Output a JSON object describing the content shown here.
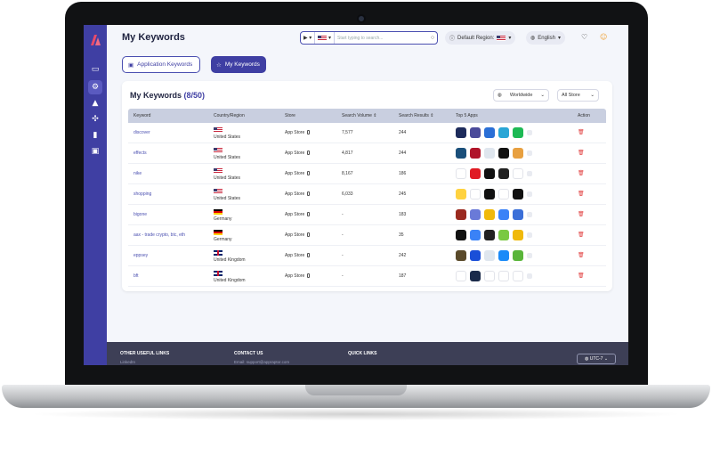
{
  "page": {
    "title": "My Keywords"
  },
  "header": {
    "search_placeholder": "Start typing to search...",
    "default_region_label": "Default Region:",
    "language": "English"
  },
  "tabs": [
    {
      "label": "Application Keywords",
      "active": false
    },
    {
      "label": "My Keywords",
      "active": true
    }
  ],
  "card": {
    "title": "My Keywords",
    "count": "(8/50)",
    "region_dropdown": "Worldwide",
    "store_dropdown": "All Store"
  },
  "table": {
    "headers": [
      "Keyword",
      "Country/Region",
      "Store",
      "Search Volume",
      "Search Results",
      "Top 5 Apps",
      "Action"
    ],
    "rows": [
      {
        "keyword": "discover",
        "flag": "us",
        "country": "United States",
        "store": "App Store",
        "volume": "7,577",
        "results": "244",
        "apps": [
          "#1d2b5b",
          "#4a4a9a",
          "#2a6fd6",
          "#2aa6d6",
          "#1db954"
        ]
      },
      {
        "keyword": "effects",
        "flag": "us",
        "country": "United States",
        "store": "App Store",
        "volume": "4,817",
        "results": "244",
        "apps": [
          "#1a4f7a",
          "#b0142a",
          "#dfe6ee",
          "#111111",
          "#e8a040"
        ]
      },
      {
        "keyword": "nike",
        "flag": "us",
        "country": "United States",
        "store": "App Store",
        "volume": "8,167",
        "results": "186",
        "apps": [
          "#ffffff",
          "#e01b24",
          "#111111",
          "#222222",
          "#ffffff"
        ]
      },
      {
        "keyword": "shopping",
        "flag": "us",
        "country": "United States",
        "store": "App Store",
        "volume": "6,033",
        "results": "245",
        "apps": [
          "#ffd23f",
          "#ffffff",
          "#111111",
          "#ffffff",
          "#111111"
        ]
      },
      {
        "keyword": "bigone",
        "flag": "de",
        "country": "Germany",
        "store": "App Store",
        "volume": "-",
        "results": "183",
        "apps": [
          "#9b2a1f",
          "#6a7ad8",
          "#f0b90b",
          "#3a82f7",
          "#3b6fd8"
        ]
      },
      {
        "keyword": "aax - trade crypto, btc, eth",
        "flag": "de",
        "country": "Germany",
        "store": "App Store",
        "volume": "-",
        "results": "35",
        "apps": [
          "#111111",
          "#3a82f7",
          "#222222",
          "#7ac943",
          "#f0b90b"
        ]
      },
      {
        "keyword": "eppsey",
        "flag": "uk",
        "country": "United Kingdom",
        "store": "App Store",
        "volume": "-",
        "results": "242",
        "apps": [
          "#5a4a2a",
          "#1a4fd8",
          "#dfe6ee",
          "#1a8af8",
          "#5ab53a"
        ]
      },
      {
        "keyword": "bft",
        "flag": "uk",
        "country": "United Kingdom",
        "store": "App Store",
        "volume": "-",
        "results": "187",
        "apps": [
          "#ffffff",
          "#1a2a4a",
          "#ffffff",
          "#ffffff",
          "#ffffff"
        ]
      }
    ]
  },
  "footer": {
    "col1": "OTHER USEFUL LINKS",
    "col1_sub": "LinkedIn",
    "col2": "CONTACT US",
    "col2_sub": "Email: support@appraptor.com",
    "col3": "QUICK LINKS",
    "timezone": "UTC-7"
  },
  "colors": {
    "brand": "#3f3fa3",
    "danger": "#e03b3b"
  }
}
